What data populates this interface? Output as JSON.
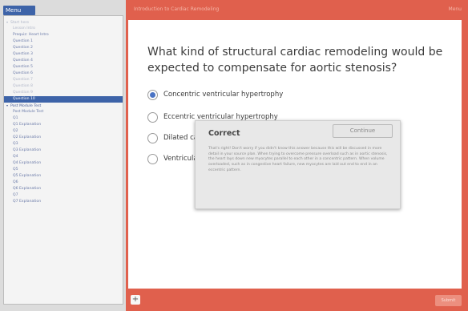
{
  "sidebar": {
    "menu_label": "Menu",
    "items": [
      {
        "label": "Start here",
        "level": 0,
        "state": "dim",
        "toggle": "▾"
      },
      {
        "label": "Lesson Intro",
        "level": 1,
        "state": "dim"
      },
      {
        "label": "Prequiz: Heart Intro",
        "level": 1,
        "state": "normal"
      },
      {
        "label": "Question 1",
        "level": 1,
        "state": "normal"
      },
      {
        "label": "Question 2",
        "level": 1,
        "state": "normal"
      },
      {
        "label": "Question 3",
        "level": 1,
        "state": "normal"
      },
      {
        "label": "Question 4",
        "level": 1,
        "state": "normal"
      },
      {
        "label": "Question 5",
        "level": 1,
        "state": "normal"
      },
      {
        "label": "Question 6",
        "level": 1,
        "state": "normal"
      },
      {
        "label": "Question 7",
        "level": 1,
        "state": "dim"
      },
      {
        "label": "Question 8",
        "level": 1,
        "state": "dim"
      },
      {
        "label": "Question 9",
        "level": 1,
        "state": "dim"
      },
      {
        "label": "Question 10",
        "level": 1,
        "state": "active"
      },
      {
        "label": "Post Module Test",
        "level": 0,
        "state": "normal",
        "toggle": "▾"
      },
      {
        "label": "Post Module Test",
        "level": 1,
        "state": "normal"
      },
      {
        "label": "Q1",
        "level": 1,
        "state": "normal"
      },
      {
        "label": "Q1 Explanation",
        "level": 1,
        "state": "normal"
      },
      {
        "label": "Q2",
        "level": 1,
        "state": "normal"
      },
      {
        "label": "Q2 Explanation",
        "level": 1,
        "state": "normal"
      },
      {
        "label": "Q3",
        "level": 1,
        "state": "normal"
      },
      {
        "label": "Q3 Explanation",
        "level": 1,
        "state": "normal"
      },
      {
        "label": "Q4",
        "level": 1,
        "state": "normal"
      },
      {
        "label": "Q4 Explanation",
        "level": 1,
        "state": "normal"
      },
      {
        "label": "Q5",
        "level": 1,
        "state": "normal"
      },
      {
        "label": "Q5 Explanation",
        "level": 1,
        "state": "normal"
      },
      {
        "label": "Q6",
        "level": 1,
        "state": "normal"
      },
      {
        "label": "Q6 Explanation",
        "level": 1,
        "state": "normal"
      },
      {
        "label": "Q7",
        "level": 1,
        "state": "normal"
      },
      {
        "label": "Q7 Explanation",
        "level": 1,
        "state": "normal"
      }
    ]
  },
  "header": {
    "title": "Introduction to Cardiac Remodeling",
    "right_text": "Menu"
  },
  "question": {
    "text": "What kind of structural cardiac remodeling would be expected to compensate for aortic stenosis?",
    "options": [
      {
        "label": "Concentric ventricular hypertrophy",
        "selected": true
      },
      {
        "label": "Eccentric ventricular hypertrophy",
        "selected": false
      },
      {
        "label": "Dilated cardiomyopathy",
        "selected": false
      },
      {
        "label": "Ventricular wall thinning",
        "selected": false
      }
    ]
  },
  "dialog": {
    "title": "Correct",
    "continue_label": "Continue",
    "body": "That's right! Don't worry if you didn't know this answer because this will be discussed in more detail in your source plan. When trying to overcome pressure overload such as in aortic stenosis, the heart lays down new myocytes parallel to each other in a concentric pattern. When volume overloaded, such as in congestive heart failure, new myocytes are laid out end to end in an eccentric pattern."
  },
  "footer": {
    "add_label": "+",
    "submit_label": "Submit"
  },
  "colors": {
    "brand_red": "#e0604d",
    "menu_blue": "#3d63a8",
    "radio_blue": "#4a73c4"
  }
}
